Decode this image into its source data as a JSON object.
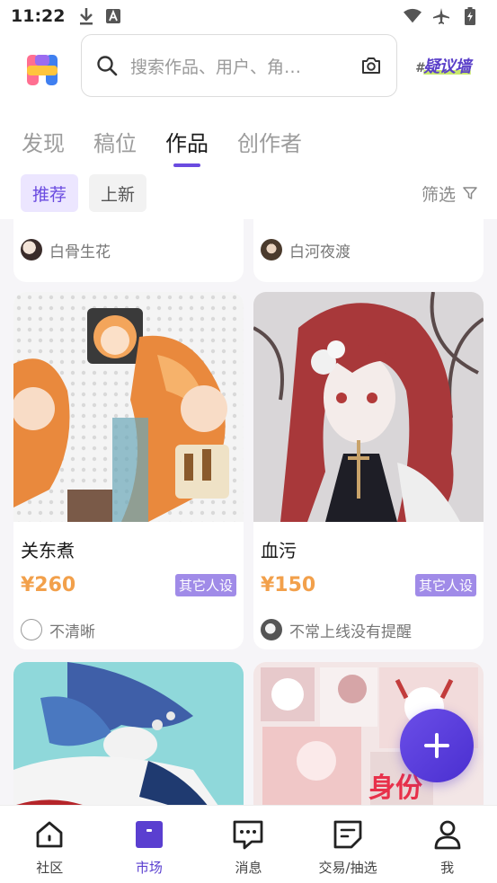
{
  "status_bar": {
    "time": "11:22",
    "icons": [
      "download-icon",
      "a-box-icon",
      "wifi-icon",
      "airplane-icon",
      "battery-charging-icon"
    ]
  },
  "header": {
    "search_placeholder": "搜索作品、用户、角…",
    "brand_hash": "#",
    "brand_text": "疑议墙"
  },
  "tabs": [
    {
      "label": "发现",
      "active": false
    },
    {
      "label": "稿位",
      "active": false
    },
    {
      "label": "作品",
      "active": true
    },
    {
      "label": "创作者",
      "active": false
    }
  ],
  "filters": {
    "chips": [
      {
        "label": "推荐",
        "active": true
      },
      {
        "label": "上新",
        "active": false
      }
    ],
    "filter_label": "筛选"
  },
  "cards_partial_top": [
    {
      "author": "白骨生花"
    },
    {
      "author": "白河夜渡"
    }
  ],
  "cards": [
    {
      "title": "关东煮",
      "price": "¥260",
      "tag": "其它人设",
      "author": "不清晰"
    },
    {
      "title": "血污",
      "price": "¥150",
      "tag": "其它人设",
      "author": "不常上线没有提醒"
    }
  ],
  "bottom_nav": [
    {
      "label": "社区",
      "icon": "home-icon",
      "active": false
    },
    {
      "label": "市场",
      "icon": "shop-bag-icon",
      "active": true
    },
    {
      "label": "消息",
      "icon": "message-icon",
      "active": false
    },
    {
      "label": "交易/抽选",
      "icon": "note-icon",
      "active": false
    },
    {
      "label": "我",
      "icon": "person-icon",
      "active": false
    }
  ],
  "colors": {
    "accent": "#6a4be0",
    "price": "#f2a04b",
    "tag_bg": "#a08be8"
  }
}
